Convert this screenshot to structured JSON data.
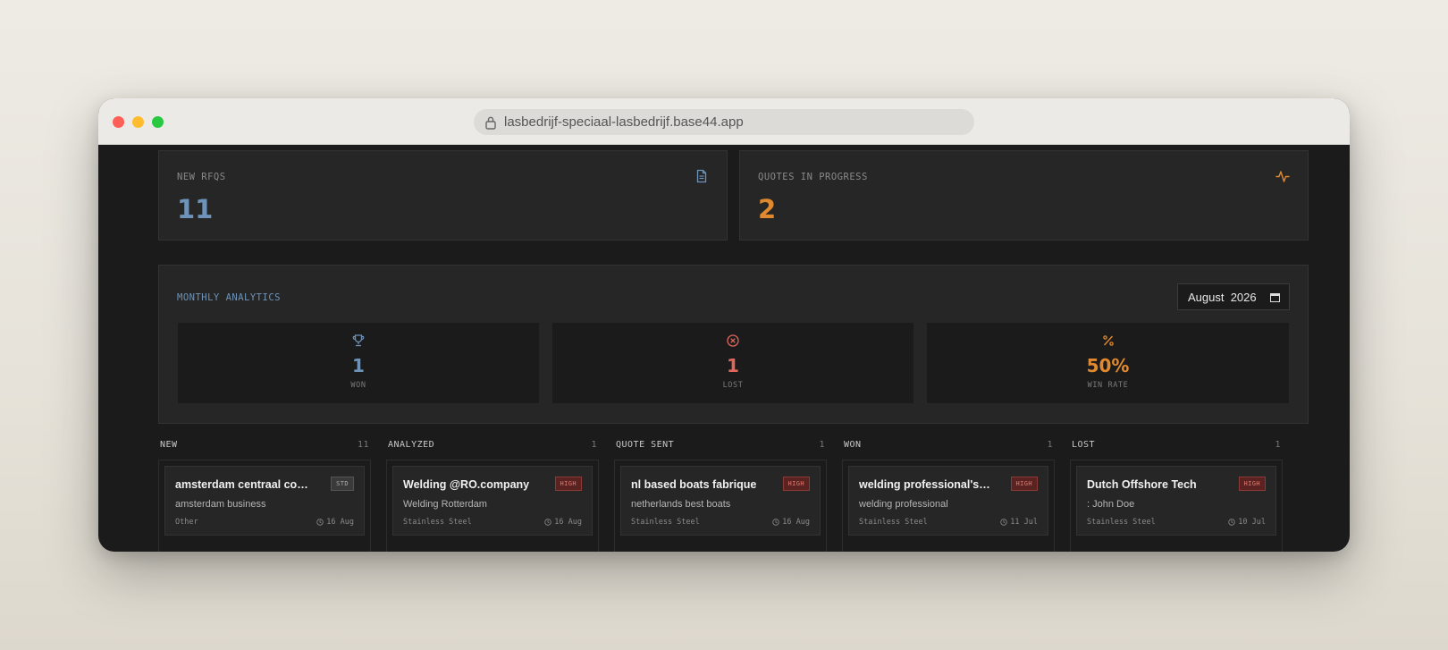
{
  "browser": {
    "url": "lasbedrijf-speciaal-lasbedrijf.base44.app"
  },
  "stats": {
    "new_rfqs": {
      "label": "NEW RFQS",
      "value": "11",
      "icon": "document-icon"
    },
    "quotes_in_progress": {
      "label": "QUOTES IN PROGRESS",
      "value": "2",
      "icon": "activity-icon"
    }
  },
  "analytics": {
    "title": "MONTHLY ANALYTICS",
    "month": "August  2026",
    "metrics": [
      {
        "label": "WON",
        "value": "1",
        "icon": "trophy-icon",
        "color": "#6e93b8"
      },
      {
        "label": "LOST",
        "value": "1",
        "icon": "x-circle-icon",
        "color": "#e0675c"
      },
      {
        "label": "WIN RATE",
        "value": "50%",
        "icon": "percent-icon",
        "color": "#e0892e"
      }
    ]
  },
  "pipeline": {
    "columns": [
      {
        "title": "NEW",
        "count": "11",
        "card": {
          "title": "amsterdam centraal company",
          "badge": "STD",
          "subtitle": "amsterdam business",
          "material": "Other",
          "date": "16 Aug"
        }
      },
      {
        "title": "ANALYZED",
        "count": "1",
        "card": {
          "title": "Welding @RO.company",
          "badge": "HIGH",
          "subtitle": "Welding Rotterdam",
          "material": "Stainless Steel",
          "date": "16 Aug"
        }
      },
      {
        "title": "QUOTE SENT",
        "count": "1",
        "card": {
          "title": "nl based boats fabrique",
          "badge": "HIGH",
          "subtitle": "netherlands best boats",
          "material": "Stainless Steel",
          "date": "16 Aug"
        }
      },
      {
        "title": "WON",
        "count": "1",
        "card": {
          "title": "welding professional's company",
          "badge": "HIGH",
          "subtitle": "welding professional",
          "material": "Stainless Steel",
          "date": "11 Jul"
        }
      },
      {
        "title": "LOST",
        "count": "1",
        "card": {
          "title": "Dutch Offshore Tech",
          "badge": "HIGH",
          "subtitle": ": John Doe",
          "material": "Stainless Steel",
          "date": "10 Jul"
        }
      }
    ]
  },
  "colors": {
    "accent_blue": "#6e93b8",
    "accent_orange": "#e0892e",
    "accent_red": "#e0675c",
    "background": "#1b1b1b",
    "panel": "#262626"
  }
}
